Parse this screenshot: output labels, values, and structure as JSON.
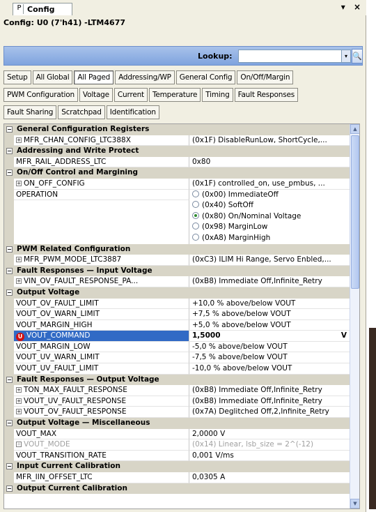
{
  "tab": {
    "icon_letter": "P",
    "title": "Config",
    "pin_glyph": "▾",
    "close_glyph": "×"
  },
  "header": "Config: U0 (7'h41) -LTM4677",
  "lookup": {
    "label": "Lookup:",
    "value": "",
    "dropdown_glyph": "▾",
    "search_glyph": "🔍"
  },
  "buttons": {
    "row1": [
      {
        "label": "Setup"
      },
      {
        "label": "All Global"
      },
      {
        "label": "All Paged"
      },
      {
        "label": "Addressing/WP"
      },
      {
        "label": "General Config"
      },
      {
        "label": "On/Off/Margin"
      }
    ],
    "row2": [
      {
        "label": "PWM Configuration"
      },
      {
        "label": "Voltage"
      },
      {
        "label": "Current"
      },
      {
        "label": "Temperature"
      },
      {
        "label": "Timing"
      },
      {
        "label": "Fault Responses"
      }
    ],
    "row3": [
      {
        "label": "Fault Sharing"
      },
      {
        "label": "Scratchpad"
      },
      {
        "label": "Identification"
      }
    ],
    "active": "All Paged"
  },
  "grid": {
    "expander_glyph": "−",
    "plus_glyph": "+",
    "rows": [
      {
        "kind": "cat",
        "label": "General Configuration Registers"
      },
      {
        "kind": "prop",
        "name": "MFR_CHAN_CONFIG_LTC388X",
        "value": "(0x1F)  DisableRunLow, ShortCycle,...",
        "expandable": true
      },
      {
        "kind": "cat",
        "label": "Addressing and Write Protect"
      },
      {
        "kind": "prop",
        "name": "MFR_RAIL_ADDRESS_LTC",
        "value": "0x80"
      },
      {
        "kind": "cat",
        "label": "On/Off Control and Margining"
      },
      {
        "kind": "prop",
        "name": "ON_OFF_CONFIG",
        "value": "(0x1F)  controlled_on, use_pmbus, ...",
        "expandable": true
      },
      {
        "kind": "radio",
        "name": "OPERATION",
        "options": [
          {
            "label": "(0x00) ImmediateOff",
            "checked": false
          },
          {
            "label": "(0x40) SoftOff",
            "checked": false
          },
          {
            "label": "(0x80) On/Nominal Voltage",
            "checked": true
          },
          {
            "label": "(0x98) MarginLow",
            "checked": false
          },
          {
            "label": "(0xA8) MarginHigh",
            "checked": false
          }
        ]
      },
      {
        "kind": "cat",
        "label": "PWM Related Configuration"
      },
      {
        "kind": "prop",
        "name": "MFR_PWM_MODE_LTC3887",
        "value": "(0xC3) ILIM Hi Range, Servo Enbled,...",
        "expandable": true
      },
      {
        "kind": "cat",
        "label": "Fault Responses — Input Voltage"
      },
      {
        "kind": "prop",
        "name": "VIN_OV_FAULT_RESPONSE_PA...",
        "value": "(0xB8) Immediate Off,Infinite_Retry",
        "expandable": true
      },
      {
        "kind": "cat",
        "label": "Output Voltage"
      },
      {
        "kind": "prop",
        "name": "VOUT_OV_FAULT_LIMIT",
        "value": "+10,0 % above/below VOUT"
      },
      {
        "kind": "prop",
        "name": "VOUT_OV_WARN_LIMIT",
        "value": "+7,5 % above/below VOUT"
      },
      {
        "kind": "prop",
        "name": "VOUT_MARGIN_HIGH",
        "value": "+5,0 % above/below VOUT"
      },
      {
        "kind": "prop",
        "name": "VOUT_COMMAND",
        "value": "1,5000",
        "selected": true,
        "badge": "U",
        "dropdown": "V"
      },
      {
        "kind": "prop",
        "name": "VOUT_MARGIN_LOW",
        "value": "-5,0 % above/below VOUT"
      },
      {
        "kind": "prop",
        "name": "VOUT_UV_WARN_LIMIT",
        "value": "-7,5 % above/below VOUT"
      },
      {
        "kind": "prop",
        "name": "VOUT_UV_FAULT_LIMIT",
        "value": "-10,0 % above/below VOUT"
      },
      {
        "kind": "cat",
        "label": "Fault Responses — Output Voltage"
      },
      {
        "kind": "prop",
        "name": "TON_MAX_FAULT_RESPONSE",
        "value": "(0xB8) Immediate Off,Infinite_Retry",
        "expandable": true
      },
      {
        "kind": "prop",
        "name": "VOUT_UV_FAULT_RESPONSE",
        "value": "(0xB8) Immediate Off,Infinite_Retry",
        "expandable": true
      },
      {
        "kind": "prop",
        "name": "VOUT_OV_FAULT_RESPONSE",
        "value": "(0x7A) Deglitched Off,2,Infinite_Retry",
        "expandable": true
      },
      {
        "kind": "cat",
        "label": "Output Voltage — Miscellaneous"
      },
      {
        "kind": "prop",
        "name": "VOUT_MAX",
        "value": "2,0000 V"
      },
      {
        "kind": "prop",
        "name": "VOUT_MODE",
        "value": "(0x14) Linear, lsb_size = 2^(-12)",
        "expandable": true,
        "disabled": true
      },
      {
        "kind": "prop",
        "name": "VOUT_TRANSITION_RATE",
        "value": "0,001 V/ms"
      },
      {
        "kind": "cat",
        "label": "Input Current Calibration"
      },
      {
        "kind": "prop",
        "name": "MFR_IIN_OFFSET_LTC",
        "value": "0,0305 A"
      },
      {
        "kind": "cat",
        "label": "Output Current Calibration"
      }
    ]
  },
  "scrollbar": {
    "up_glyph": "▲",
    "down_glyph": "▼"
  },
  "colors": {
    "panel": "#f1efe2",
    "category_row": "#d8d5c7",
    "lookup_bar": "#7fa3de",
    "selection": "#316ac5",
    "badge_red": "#d21010",
    "radio_checked": "#2e8b2e"
  }
}
